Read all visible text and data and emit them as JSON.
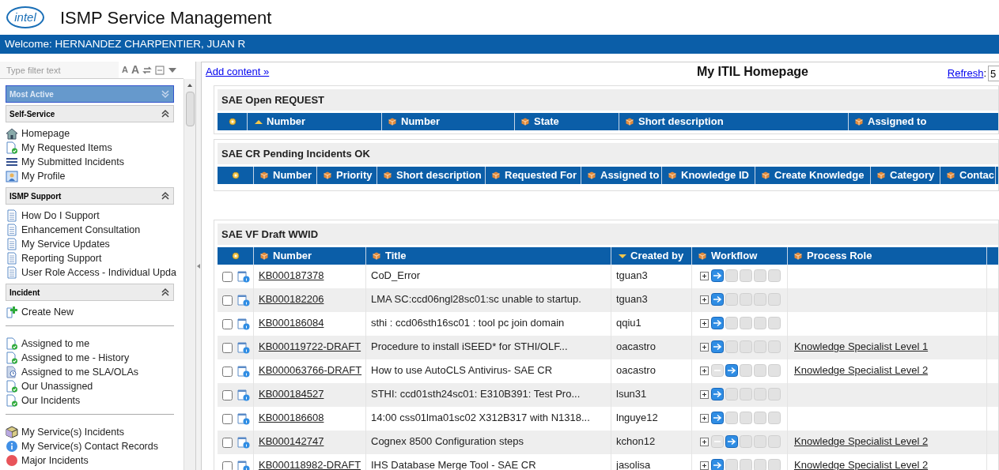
{
  "header": {
    "logo": "intel",
    "title": "ISMP Service Management"
  },
  "welcome": "Welcome: HERNANDEZ CHARPENTIER, JUAN R",
  "sidebar": {
    "filter": {
      "placeholder": "Type filter text"
    },
    "font_small": "A",
    "font_large": "A",
    "sections": [
      {
        "title": "Most Active",
        "selected": true,
        "expanded": false
      },
      {
        "title": "Self-Service",
        "selected": false,
        "expanded": true,
        "groups": [
          [
            {
              "label": "Homepage",
              "kind": "home"
            },
            {
              "label": "My Requested Items",
              "kind": "request"
            },
            {
              "label": "My Submitted Incidents",
              "kind": "list"
            },
            {
              "label": "My Profile",
              "kind": "profile"
            }
          ]
        ]
      },
      {
        "title": "ISMP Support",
        "selected": false,
        "expanded": true,
        "groups": [
          [
            {
              "label": "How Do I Support",
              "kind": "page"
            },
            {
              "label": "Enhancement Consultation",
              "kind": "page"
            },
            {
              "label": "My Service Updates",
              "kind": "page"
            },
            {
              "label": "Reporting Support",
              "kind": "page"
            },
            {
              "label": "User Role Access - Individual Upda",
              "kind": "page"
            }
          ]
        ]
      },
      {
        "title": "Incident",
        "selected": false,
        "expanded": true,
        "groups": [
          [
            {
              "label": "Create New",
              "kind": "create"
            }
          ],
          [
            {
              "label": "Assigned to me",
              "kind": "request"
            },
            {
              "label": "Assigned to me - History",
              "kind": "request"
            },
            {
              "label": "Assigned to me SLA/OLAs",
              "kind": "sla"
            },
            {
              "label": "Our Unassigned",
              "kind": "request"
            },
            {
              "label": "Our Incidents",
              "kind": "request"
            }
          ],
          [
            {
              "label": "My Service(s) Incidents",
              "kind": "box"
            },
            {
              "label": "My Service(s) Contact Records",
              "kind": "info"
            },
            {
              "label": "Major Incidents",
              "kind": "alert"
            }
          ]
        ]
      }
    ]
  },
  "main": {
    "add_content": "Add content »",
    "title": "My ITIL Homepage",
    "refresh_label": "Refresh",
    "refresh_separator": ":",
    "refresh_value": "5",
    "panels": [
      {
        "title": "SAE Open REQUEST",
        "columns": [
          {
            "label": "Number",
            "sorted_up": true,
            "sorted_down": false
          },
          {
            "label": "Number",
            "sorted_up": false,
            "sorted_down": false
          },
          {
            "label": "State",
            "sorted_up": false,
            "sorted_down": false
          },
          {
            "label": "Short description",
            "sorted_up": false,
            "sorted_down": false
          },
          {
            "label": "Assigned to",
            "sorted_up": false,
            "sorted_down": false
          }
        ]
      },
      {
        "title": "SAE CR Pending Incidents OK",
        "columns": [
          {
            "label": "Number",
            "sorted_up": false,
            "sorted_down": false
          },
          {
            "label": "Priority",
            "sorted_up": false,
            "sorted_down": false
          },
          {
            "label": "Short description",
            "sorted_up": false,
            "sorted_down": false
          },
          {
            "label": "Requested For",
            "sorted_up": false,
            "sorted_down": false
          },
          {
            "label": "Assigned to",
            "sorted_up": false,
            "sorted_down": false
          },
          {
            "label": "Knowledge ID",
            "sorted_up": false,
            "sorted_down": false
          },
          {
            "label": "Create Knowledge",
            "sorted_up": false,
            "sorted_down": false
          },
          {
            "label": "Category",
            "sorted_up": false,
            "sorted_down": false
          },
          {
            "label": "Contac",
            "sorted_up": false,
            "sorted_down": false
          }
        ]
      },
      {
        "title": "SAE VF Draft WWID",
        "columns": [
          {
            "label": "Number",
            "sorted_up": false,
            "sorted_down": false
          },
          {
            "label": "Title",
            "sorted_up": false,
            "sorted_down": false
          },
          {
            "label": "Created by",
            "sorted_up": false,
            "sorted_down": true
          },
          {
            "label": "Workflow",
            "sorted_up": false,
            "sorted_down": false
          },
          {
            "label": "Process Role",
            "sorted_up": false,
            "sorted_down": false
          }
        ],
        "rows": [
          {
            "checked": false,
            "number": "KB000187378",
            "title": "CoD_Error",
            "created_by": "tguan3",
            "workflow": [
              {
                "kind": "current"
              },
              {
                "kind": "pending"
              },
              {
                "kind": "pending"
              },
              {
                "kind": "pending"
              },
              {
                "kind": "pending"
              }
            ]
          },
          {
            "checked": false,
            "number": "KB000182206",
            "title": "LMA SC:ccd06ngl28sc01:sc unable to startup.",
            "created_by": "tguan3",
            "workflow": [
              {
                "kind": "current"
              },
              {
                "kind": "pending"
              },
              {
                "kind": "pending"
              },
              {
                "kind": "pending"
              },
              {
                "kind": "pending"
              }
            ]
          },
          {
            "checked": false,
            "number": "KB000186084",
            "title": "sthi : ccd06sth16sc01 : tool pc join domain",
            "created_by": "qqiu1",
            "workflow": [
              {
                "kind": "current"
              },
              {
                "kind": "pending"
              },
              {
                "kind": "pending"
              },
              {
                "kind": "pending"
              },
              {
                "kind": "pending"
              }
            ]
          },
          {
            "checked": false,
            "number": "KB000119722-DRAFT",
            "title": "Procedure to install iSEED* for STHI/OLF...",
            "created_by": "oacastro",
            "workflow": [
              {
                "kind": "current"
              },
              {
                "kind": "pending"
              },
              {
                "kind": "pending"
              },
              {
                "kind": "pending"
              },
              {
                "kind": "pending"
              }
            ],
            "role": "Knowledge Specialist Level 1"
          },
          {
            "checked": false,
            "number": "KB000063766-DRAFT",
            "title": "How to use AutoCLS Antivirus- SAE CR",
            "created_by": "oacastro",
            "workflow": [
              {
                "kind": "skipped"
              },
              {
                "kind": "current"
              },
              {
                "kind": "pending"
              },
              {
                "kind": "pending"
              },
              {
                "kind": "pending"
              }
            ],
            "role": "Knowledge Specialist Level 2"
          },
          {
            "checked": false,
            "number": "KB000184527",
            "title": "STHI: ccd01sth24sc01: E310B391: Test Pro...",
            "created_by": "lsun31",
            "workflow": [
              {
                "kind": "current"
              },
              {
                "kind": "pending"
              },
              {
                "kind": "pending"
              },
              {
                "kind": "pending"
              },
              {
                "kind": "pending"
              }
            ]
          },
          {
            "checked": false,
            "number": "KB000186608",
            "title": "14:00 css01lma01sc02 X312B317 with N1318...",
            "created_by": "lnguye12",
            "workflow": [
              {
                "kind": "current"
              },
              {
                "kind": "pending"
              },
              {
                "kind": "pending"
              },
              {
                "kind": "pending"
              },
              {
                "kind": "pending"
              }
            ]
          },
          {
            "checked": false,
            "number": "KB000142747",
            "title": "Cognex 8500 Configuration steps",
            "created_by": "kchon12",
            "workflow": [
              {
                "kind": "skipped"
              },
              {
                "kind": "current"
              },
              {
                "kind": "pending"
              },
              {
                "kind": "pending"
              },
              {
                "kind": "pending"
              }
            ],
            "role": "Knowledge Specialist Level 2"
          },
          {
            "checked": false,
            "number": "KB000118982-DRAFT",
            "title": "IHS Database Merge Tool - SAE CR",
            "created_by": "jasolisa",
            "workflow": [
              {
                "kind": "current"
              },
              {
                "kind": "pending"
              },
              {
                "kind": "pending"
              },
              {
                "kind": "pending"
              },
              {
                "kind": "pending"
              }
            ],
            "role": "Knowledge Specialist Level 2"
          }
        ]
      }
    ]
  }
}
